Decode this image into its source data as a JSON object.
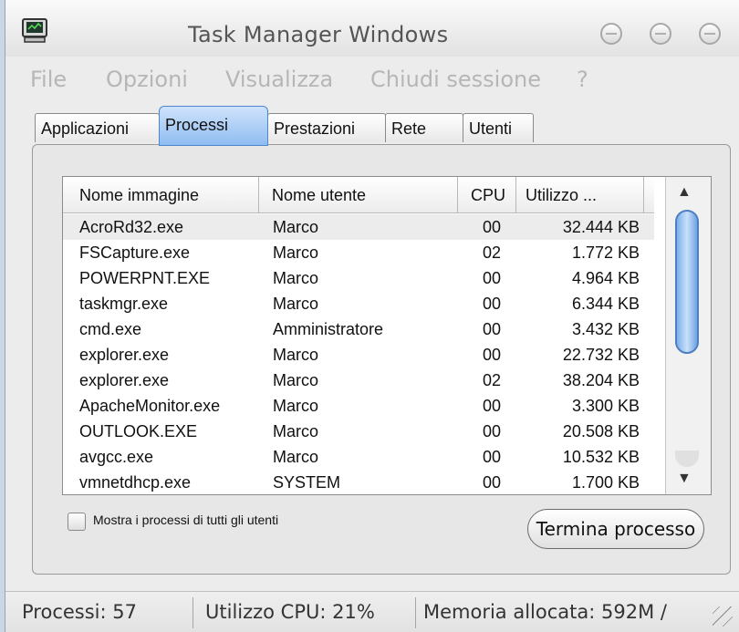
{
  "window": {
    "title": "Task Manager Windows"
  },
  "menu": [
    "File",
    "Opzioni",
    "Visualizza",
    "Chiudi sessione",
    "?"
  ],
  "tabs": [
    "Applicazioni",
    "Processi",
    "Prestazioni",
    "Rete",
    "Utenti"
  ],
  "active_tab": "Processi",
  "columns": [
    "Nome immagine",
    "Nome utente",
    "CPU",
    "Utilizzo ..."
  ],
  "processes": [
    {
      "name": "AcroRd32.exe",
      "user": "Marco",
      "cpu": "00",
      "mem": "32.444 KB"
    },
    {
      "name": "FSCapture.exe",
      "user": "Marco",
      "cpu": "02",
      "mem": "1.772 KB"
    },
    {
      "name": "POWERPNT.EXE",
      "user": "Marco",
      "cpu": "00",
      "mem": "4.964 KB"
    },
    {
      "name": "taskmgr.exe",
      "user": "Marco",
      "cpu": "00",
      "mem": "6.344 KB"
    },
    {
      "name": "cmd.exe",
      "user": "Amministratore",
      "cpu": "00",
      "mem": "3.432 KB"
    },
    {
      "name": "explorer.exe",
      "user": "Marco",
      "cpu": "00",
      "mem": "22.732 KB"
    },
    {
      "name": "explorer.exe",
      "user": "Marco",
      "cpu": "02",
      "mem": "38.204 KB"
    },
    {
      "name": "ApacheMonitor.exe",
      "user": "Marco",
      "cpu": "00",
      "mem": "3.300 KB"
    },
    {
      "name": "OUTLOOK.EXE",
      "user": "Marco",
      "cpu": "00",
      "mem": "20.508 KB"
    },
    {
      "name": "avgcc.exe",
      "user": "Marco",
      "cpu": "00",
      "mem": "10.532 KB"
    },
    {
      "name": "vmnetdhcp.exe",
      "user": "SYSTEM",
      "cpu": "00",
      "mem": "1.700 KB"
    }
  ],
  "show_all_label": "Mostra i processi di tutti gli utenti",
  "end_process_label": "Termina processo",
  "status": {
    "processes": "Processi: 57",
    "cpu": "Utilizzo CPU: 21%",
    "memory": "Memoria allocata: 592M /"
  },
  "colors": {
    "active_tab": "#8fbdf1",
    "scroll_thumb": "#7fb0ea"
  }
}
